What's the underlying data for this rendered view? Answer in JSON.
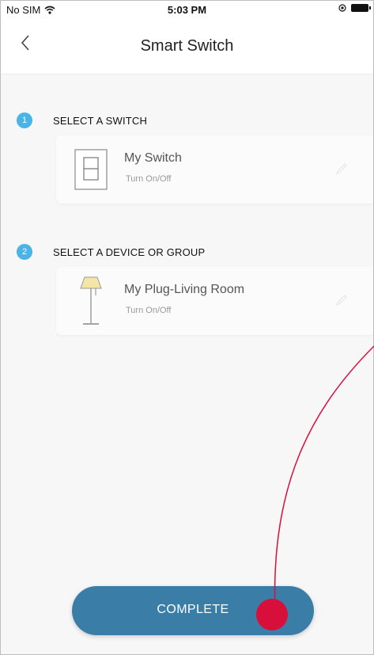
{
  "status_bar": {
    "carrier": "No SIM",
    "time": "5:03 PM"
  },
  "nav": {
    "title": "Smart Switch",
    "back_icon": "chevron-left-icon"
  },
  "steps": [
    {
      "number": "1",
      "label": "SELECT A SWITCH",
      "card": {
        "title": "My Switch",
        "subtitle": "Turn On/Off",
        "icon": "wall-switch-icon"
      }
    },
    {
      "number": "2",
      "label": "SELECT A DEVICE OR GROUP",
      "card": {
        "title": "My Plug-Living Room",
        "subtitle": "Turn On/Off",
        "icon": "floor-lamp-icon"
      }
    }
  ],
  "complete_button": {
    "label": "COMPLETE"
  },
  "colors": {
    "accent": "#4bb3e6",
    "button": "#3a7ea8",
    "annotation": "#d80f3b"
  }
}
